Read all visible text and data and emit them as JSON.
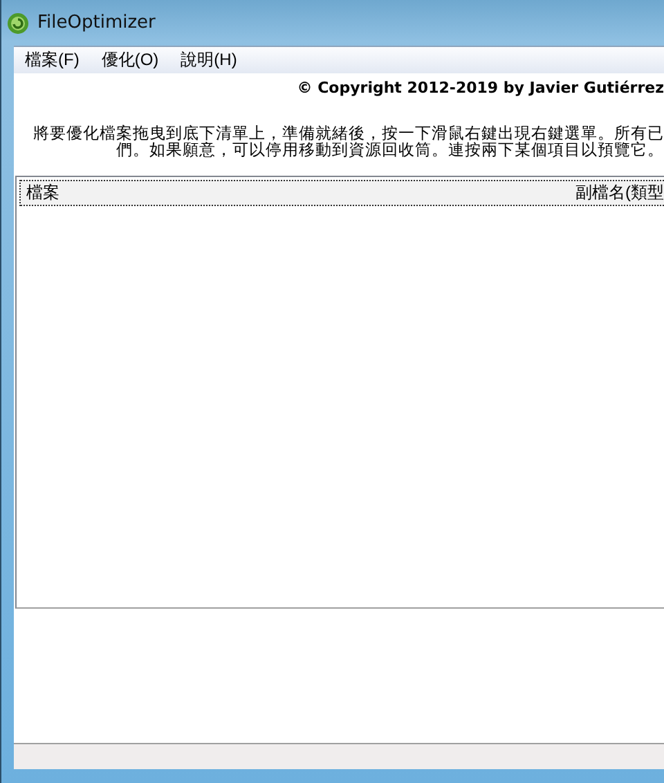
{
  "window": {
    "title": "FileOptimizer"
  },
  "menu": [
    "檔案(F)",
    "優化(O)",
    "說明(H)"
  ],
  "copyright": "© Copyright 2012-2019 by Javier Gutiérrez",
  "instructions": [
    "將要優化檔案拖曳到底下清單上，準備就緒後，按一下滑鼠右鍵出現右鍵選單。所有已",
    "們。如果願意，可以停用移動到資源回收筒。連按兩下某個項目以預覽它。"
  ],
  "file_list": {
    "columns": [
      "檔案",
      "副檔名(類型"
    ]
  }
}
